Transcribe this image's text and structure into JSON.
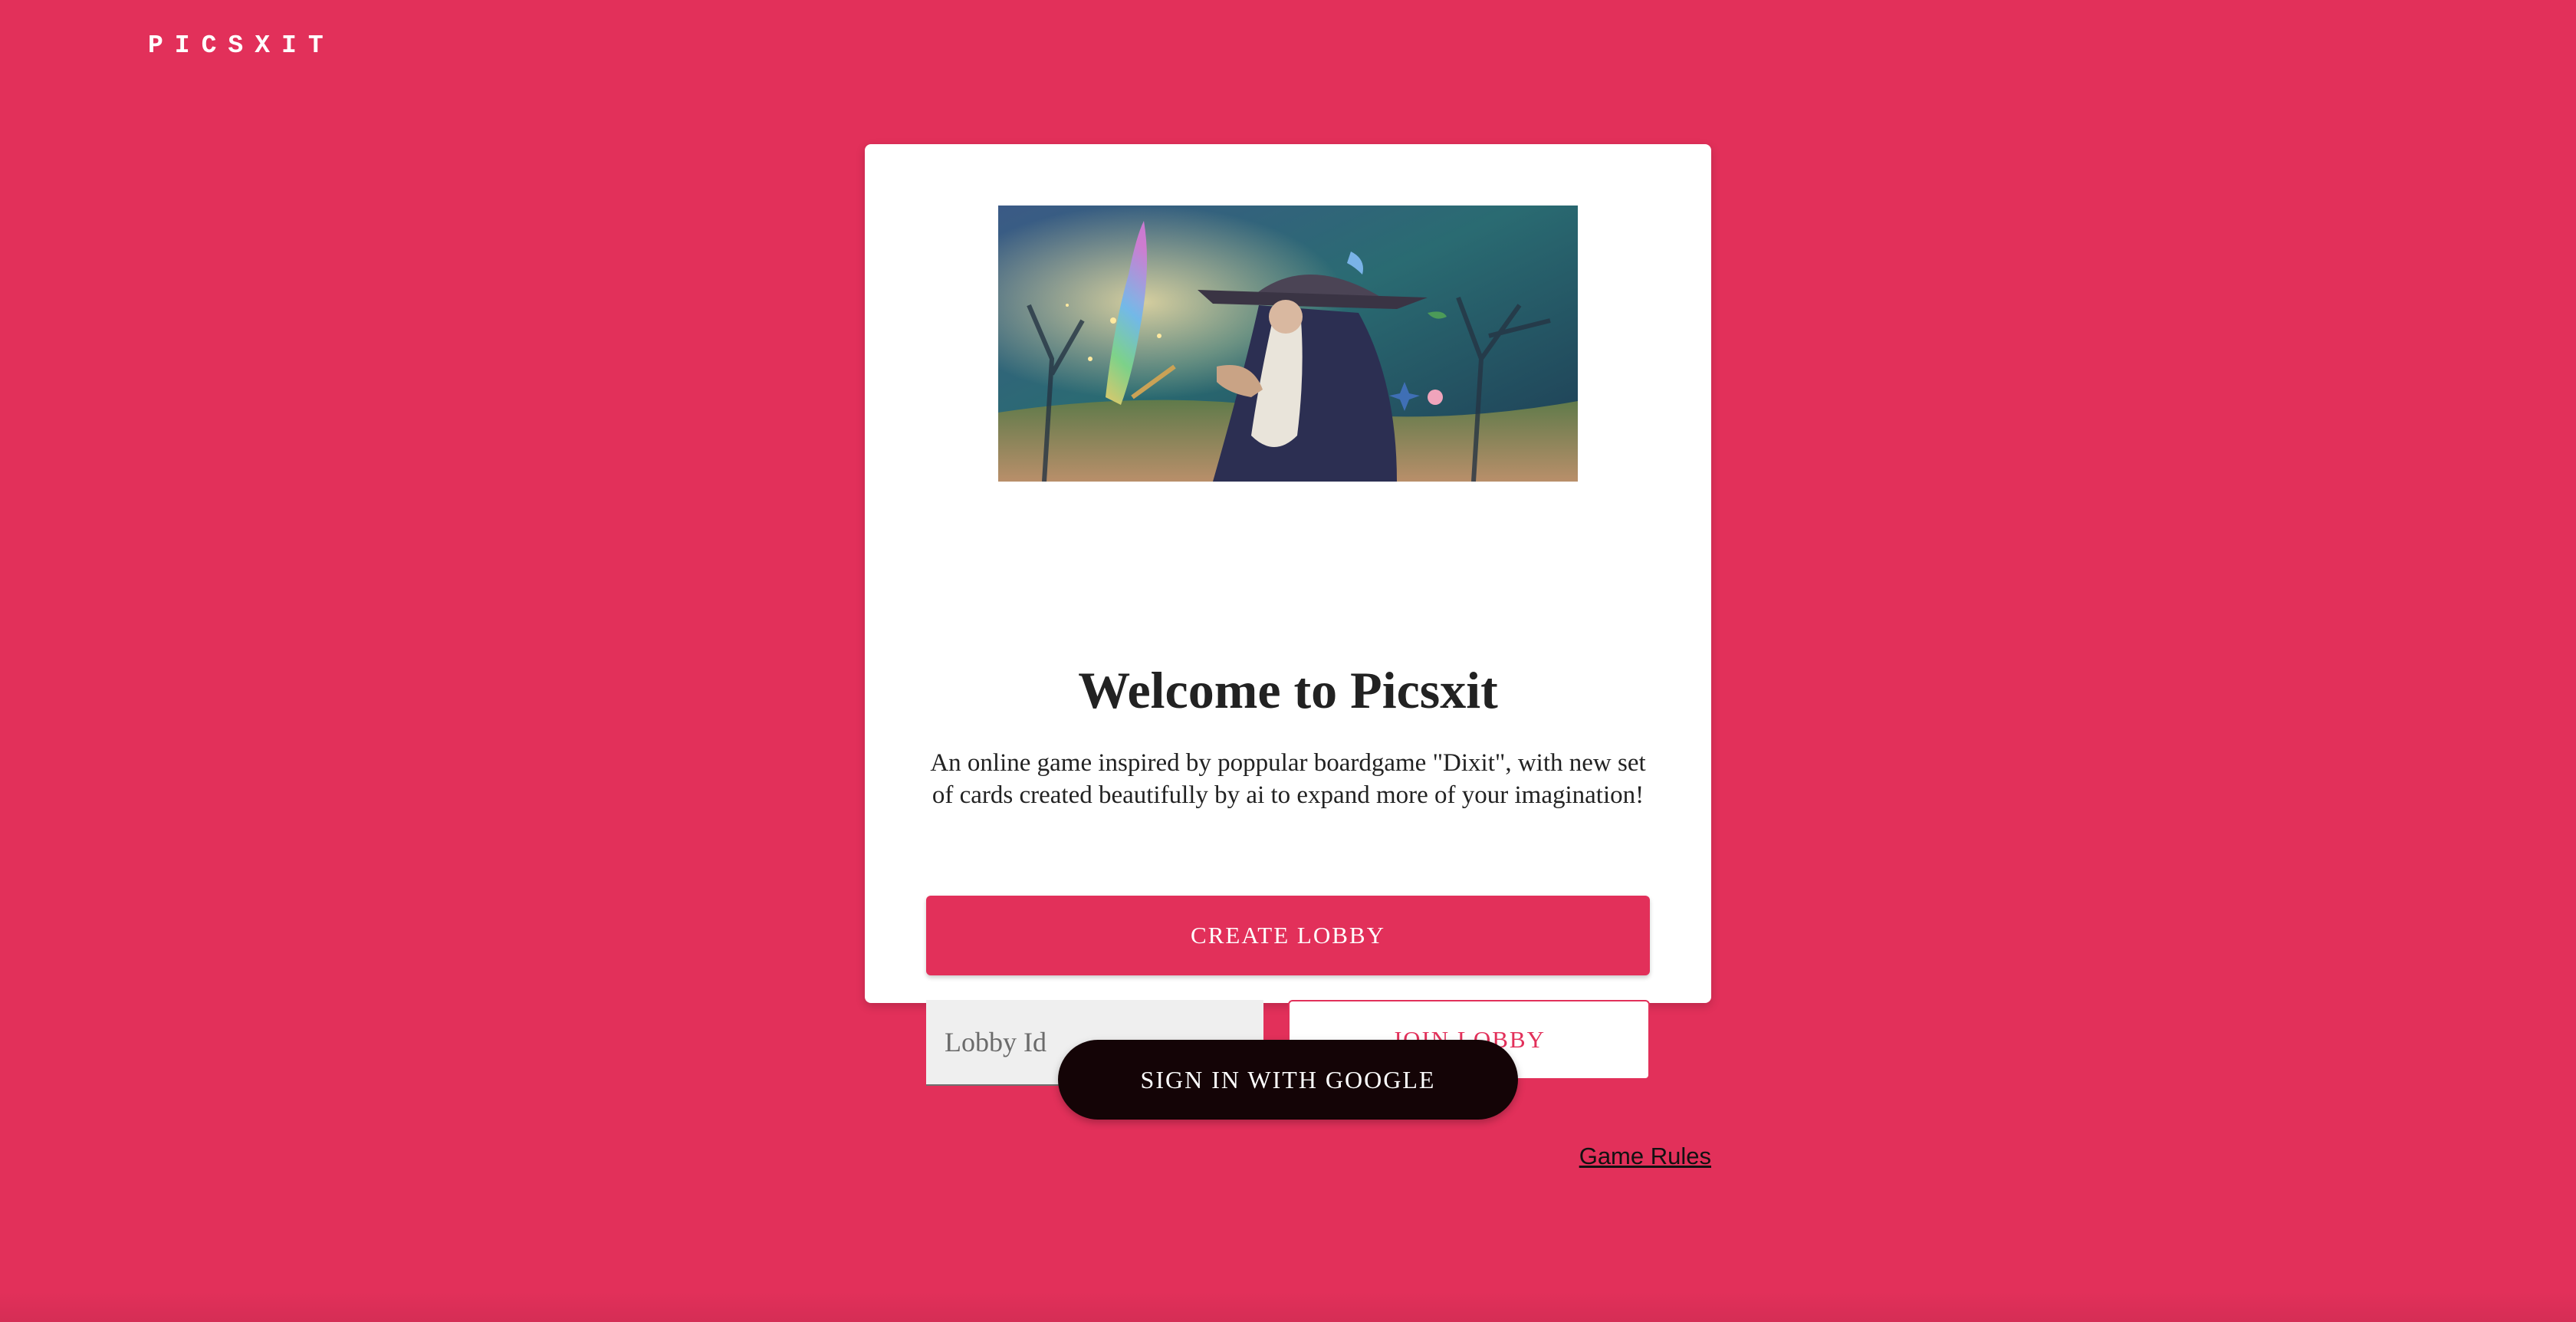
{
  "header": {
    "brand": "PICSXIT"
  },
  "card": {
    "hero_image": "wizard-illustration",
    "title": "Welcome to Picsxit",
    "description": "An online game inspired by poppular boardgame \"Dixit\", with new set of cards created beautifully by ai to expand more of your imagination!",
    "create_lobby_label": "CREATE LOBBY",
    "lobby_input": {
      "placeholder": "Lobby Id",
      "value": ""
    },
    "join_lobby_label": "JOIN LOBBY"
  },
  "auth": {
    "google_sign_in_label": "SIGN IN WITH GOOGLE"
  },
  "footer": {
    "rules_link": "Game Rules"
  },
  "colors": {
    "background": "#e2305a",
    "card": "#ffffff",
    "primary": "#e2305a",
    "google_button": "#140406",
    "text": "#222222"
  }
}
